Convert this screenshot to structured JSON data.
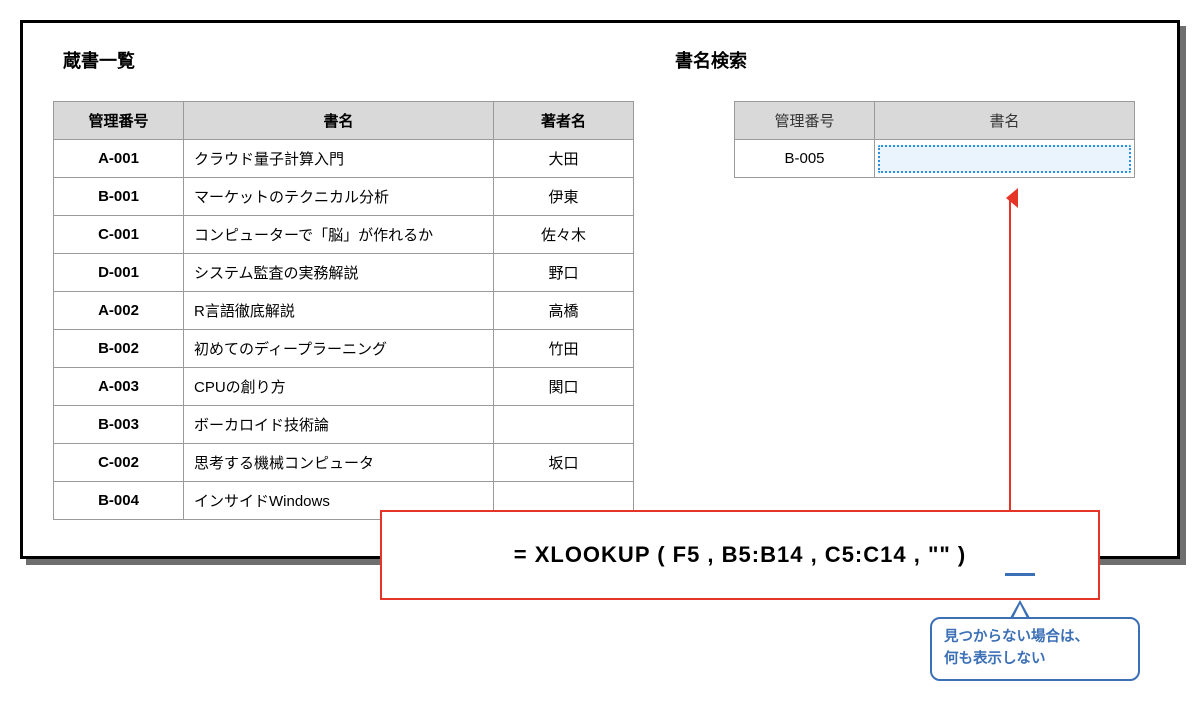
{
  "headings": {
    "left": "蔵書一覧",
    "right": "書名検索"
  },
  "library_table": {
    "headers": {
      "id": "管理番号",
      "title": "書名",
      "author": "著者名"
    },
    "rows": [
      {
        "id": "A-001",
        "title": "クラウド量子計算入門",
        "author": "大田"
      },
      {
        "id": "B-001",
        "title": "マーケットのテクニカル分析",
        "author": "伊東"
      },
      {
        "id": "C-001",
        "title": "コンピューターで「脳」が作れるか",
        "author": "佐々木"
      },
      {
        "id": "D-001",
        "title": "システム監査の実務解説",
        "author": "野口"
      },
      {
        "id": "A-002",
        "title": "R言語徹底解説",
        "author": "高橋"
      },
      {
        "id": "B-002",
        "title": "初めてのディープラーニング",
        "author": "竹田"
      },
      {
        "id": "A-003",
        "title": "CPUの創り方",
        "author": "関口"
      },
      {
        "id": "B-003",
        "title": "ボーカロイド技術論",
        "author": ""
      },
      {
        "id": "C-002",
        "title": "思考する機械コンピュータ",
        "author": "坂口"
      },
      {
        "id": "B-004",
        "title": "インサイドWindows",
        "author": ""
      }
    ]
  },
  "search_table": {
    "headers": {
      "id": "管理番号",
      "title": "書名"
    },
    "lookup_id": "B-005",
    "result": ""
  },
  "formula": "= XLOOKUP ( F5 , B5:B14 , C5:C14 , \"\" )",
  "callout": {
    "line1": "見つからない場合は、",
    "line2": "何も表示しない"
  }
}
